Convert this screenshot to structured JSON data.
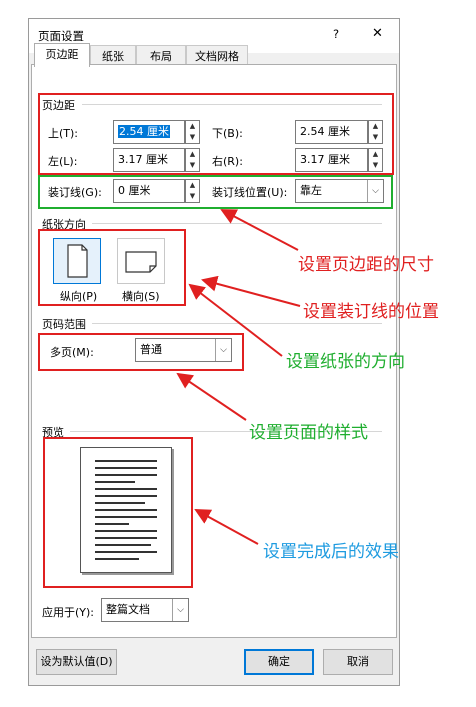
{
  "dialog": {
    "title": "页面设置",
    "help_label": "?",
    "close_label": "✕"
  },
  "tabs": [
    {
      "label": "页边距",
      "active": true
    },
    {
      "label": "纸张",
      "active": false
    },
    {
      "label": "布局",
      "active": false
    },
    {
      "label": "文档网格",
      "active": false
    }
  ],
  "margins": {
    "group_label": "页边距",
    "top_label": "上(T):",
    "top_value": "2.54 厘米",
    "bottom_label": "下(B):",
    "bottom_value": "2.54 厘米",
    "left_label": "左(L):",
    "left_value": "3.17 厘米",
    "right_label": "右(R):",
    "right_value": "3.17 厘米",
    "gutter_label": "装订线(G):",
    "gutter_value": "0 厘米",
    "gutter_pos_label": "装订线位置(U):",
    "gutter_pos_value": "靠左"
  },
  "orientation": {
    "group_label": "纸张方向",
    "portrait_label": "纵向(P)",
    "landscape_label": "横向(S)",
    "selected": "portrait"
  },
  "pages": {
    "group_label": "页码范围",
    "multiple_label": "多页(M):",
    "multiple_value": "普通"
  },
  "preview": {
    "group_label": "预览"
  },
  "apply": {
    "label": "应用于(Y):",
    "value": "整篇文档"
  },
  "buttons": {
    "default_label": "设为默认值(D)",
    "ok_label": "确定",
    "cancel_label": "取消"
  },
  "annotations": [
    {
      "text": "设置页边距的尺寸",
      "color": "#e02020"
    },
    {
      "text": "设置装订线的位置",
      "color": "#e02020"
    },
    {
      "text": "设置纸张的方向",
      "color": "#1fae2f"
    },
    {
      "text": "设置页面的样式",
      "color": "#1fae2f"
    },
    {
      "text": "设置完成后的效果",
      "color": "#1e9be0"
    }
  ],
  "colors": {
    "red": "#e02020",
    "green": "#1fae2f",
    "blue": "#1e9be0",
    "accent": "#0078d7"
  }
}
